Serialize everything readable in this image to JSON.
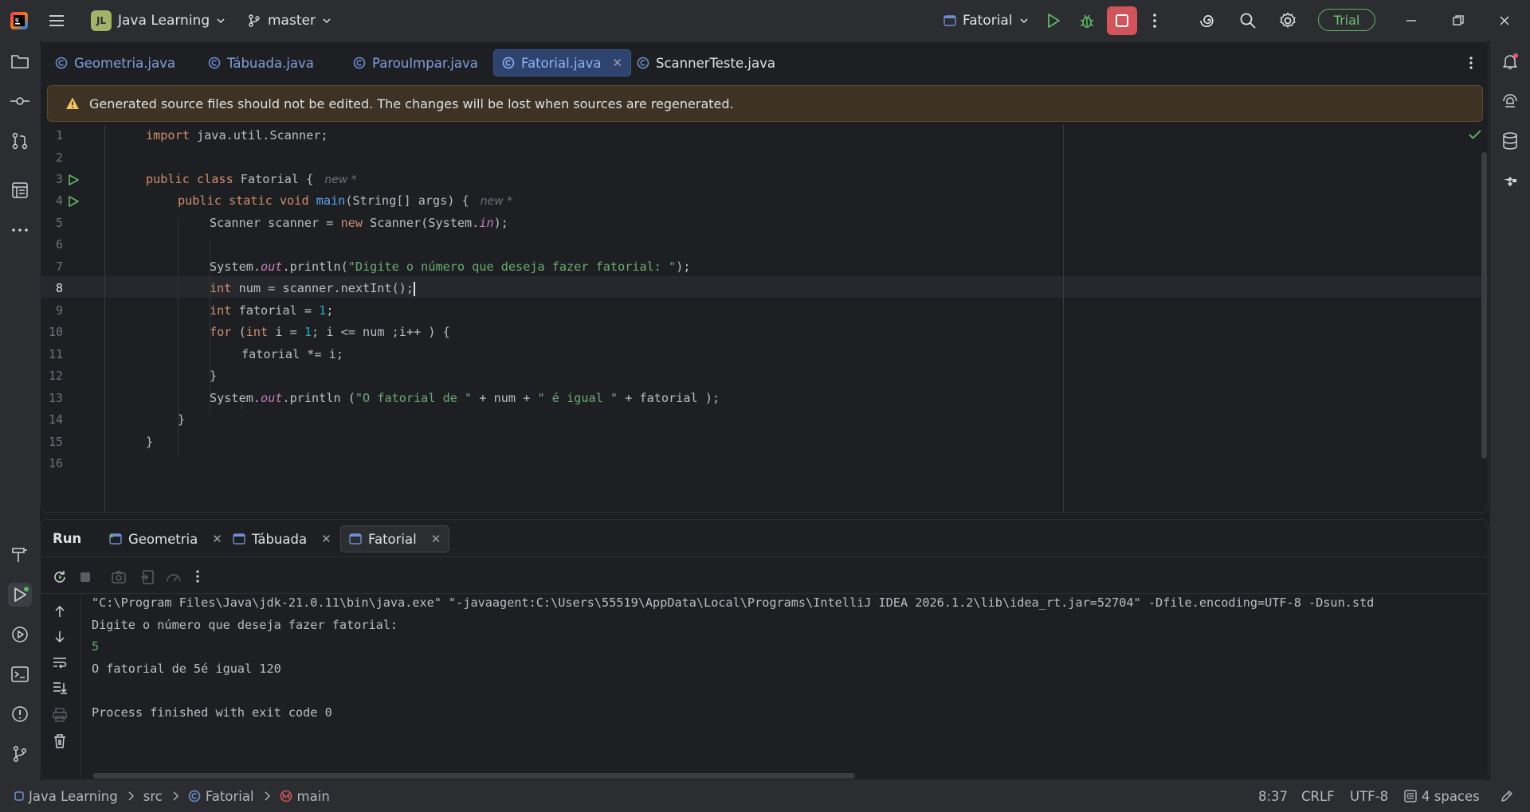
{
  "titlebar": {
    "project_badge": "JL",
    "project_name": "Java Learning",
    "branch": "master",
    "run_config": "Fatorial",
    "trial_label": "Trial"
  },
  "editor_tabs": [
    {
      "label": "Geometria.java"
    },
    {
      "label": "Tábuada.java"
    },
    {
      "label": "ParouImpar.java"
    },
    {
      "label": "Fatorial.java",
      "active": true
    },
    {
      "label": "ScannerTeste.java"
    }
  ],
  "banner": {
    "text": "Generated source files should not be edited. The changes will be lost when sources are regenerated."
  },
  "code": {
    "line_numbers": [
      "1",
      "2",
      "3",
      "4",
      "5",
      "6",
      "7",
      "8",
      "9",
      "10",
      "11",
      "12",
      "13",
      "14",
      "15",
      "16"
    ],
    "l1_import": "import",
    "l1_rest": " java.util.Scanner;",
    "l3_kw": "public class",
    "l3_rest": " Fatorial {",
    "l4_kw": "public static void",
    "l4_fn": "main",
    "l4_rest": "(String[] args) {",
    "l5_a": "Scanner scanner = ",
    "l5_new": "new",
    "l5_b": " Scanner(System.",
    "l5_in": "in",
    "l5_c": ");",
    "l7_a": "System.",
    "l7_out": "out",
    "l7_b": ".println(",
    "l7_str": "\"Digite o número que deseja fazer fatorial: \"",
    "l7_c": ");",
    "l8_int": "int",
    "l8_rest": " num = scanner.nextInt();",
    "l9_int": "int",
    "l9_a": " fatorial = ",
    "l9_num": "1",
    "l9_b": ";",
    "l10_for": "for",
    "l10_a": " (",
    "l10_int": "int",
    "l10_b": " i = ",
    "l10_num": "1",
    "l10_c": "; i <= num ;i++ ) {",
    "l11": "fatorial *= i;",
    "l12": "}",
    "l13_a": "System.",
    "l13_out": "out",
    "l13_b": ".println (",
    "l13_s1": "\"O fatorial de \"",
    "l13_c": " + num + ",
    "l13_s2": "\" é igual \"",
    "l13_d": " + fatorial );",
    "l14": "}",
    "l15": "}",
    "hint_new": "new *"
  },
  "run_panel": {
    "title": "Run",
    "tabs": [
      {
        "label": "Geometria"
      },
      {
        "label": "Tábuada"
      },
      {
        "label": "Fatorial",
        "active": true
      }
    ],
    "console": {
      "cmd": "\"C:\\Program Files\\Java\\jdk-21.0.11\\bin\\java.exe\" \"-javaagent:C:\\Users\\55519\\AppData\\Local\\Programs\\IntelliJ IDEA 2026.1.2\\lib\\idea_rt.jar=52704\" -Dfile.encoding=UTF-8 -Dsun.std",
      "prompt": "Digite o número que deseja fazer fatorial:",
      "input": "5",
      "result": "O fatorial de 5é igual 120",
      "exit": "Process finished with exit code 0"
    }
  },
  "statusbar": {
    "project": "Java Learning",
    "src": "src",
    "class": "Fatorial",
    "method": "main",
    "position": "8:37",
    "line_sep": "CRLF",
    "encoding": "UTF-8",
    "indent": "4 spaces"
  }
}
